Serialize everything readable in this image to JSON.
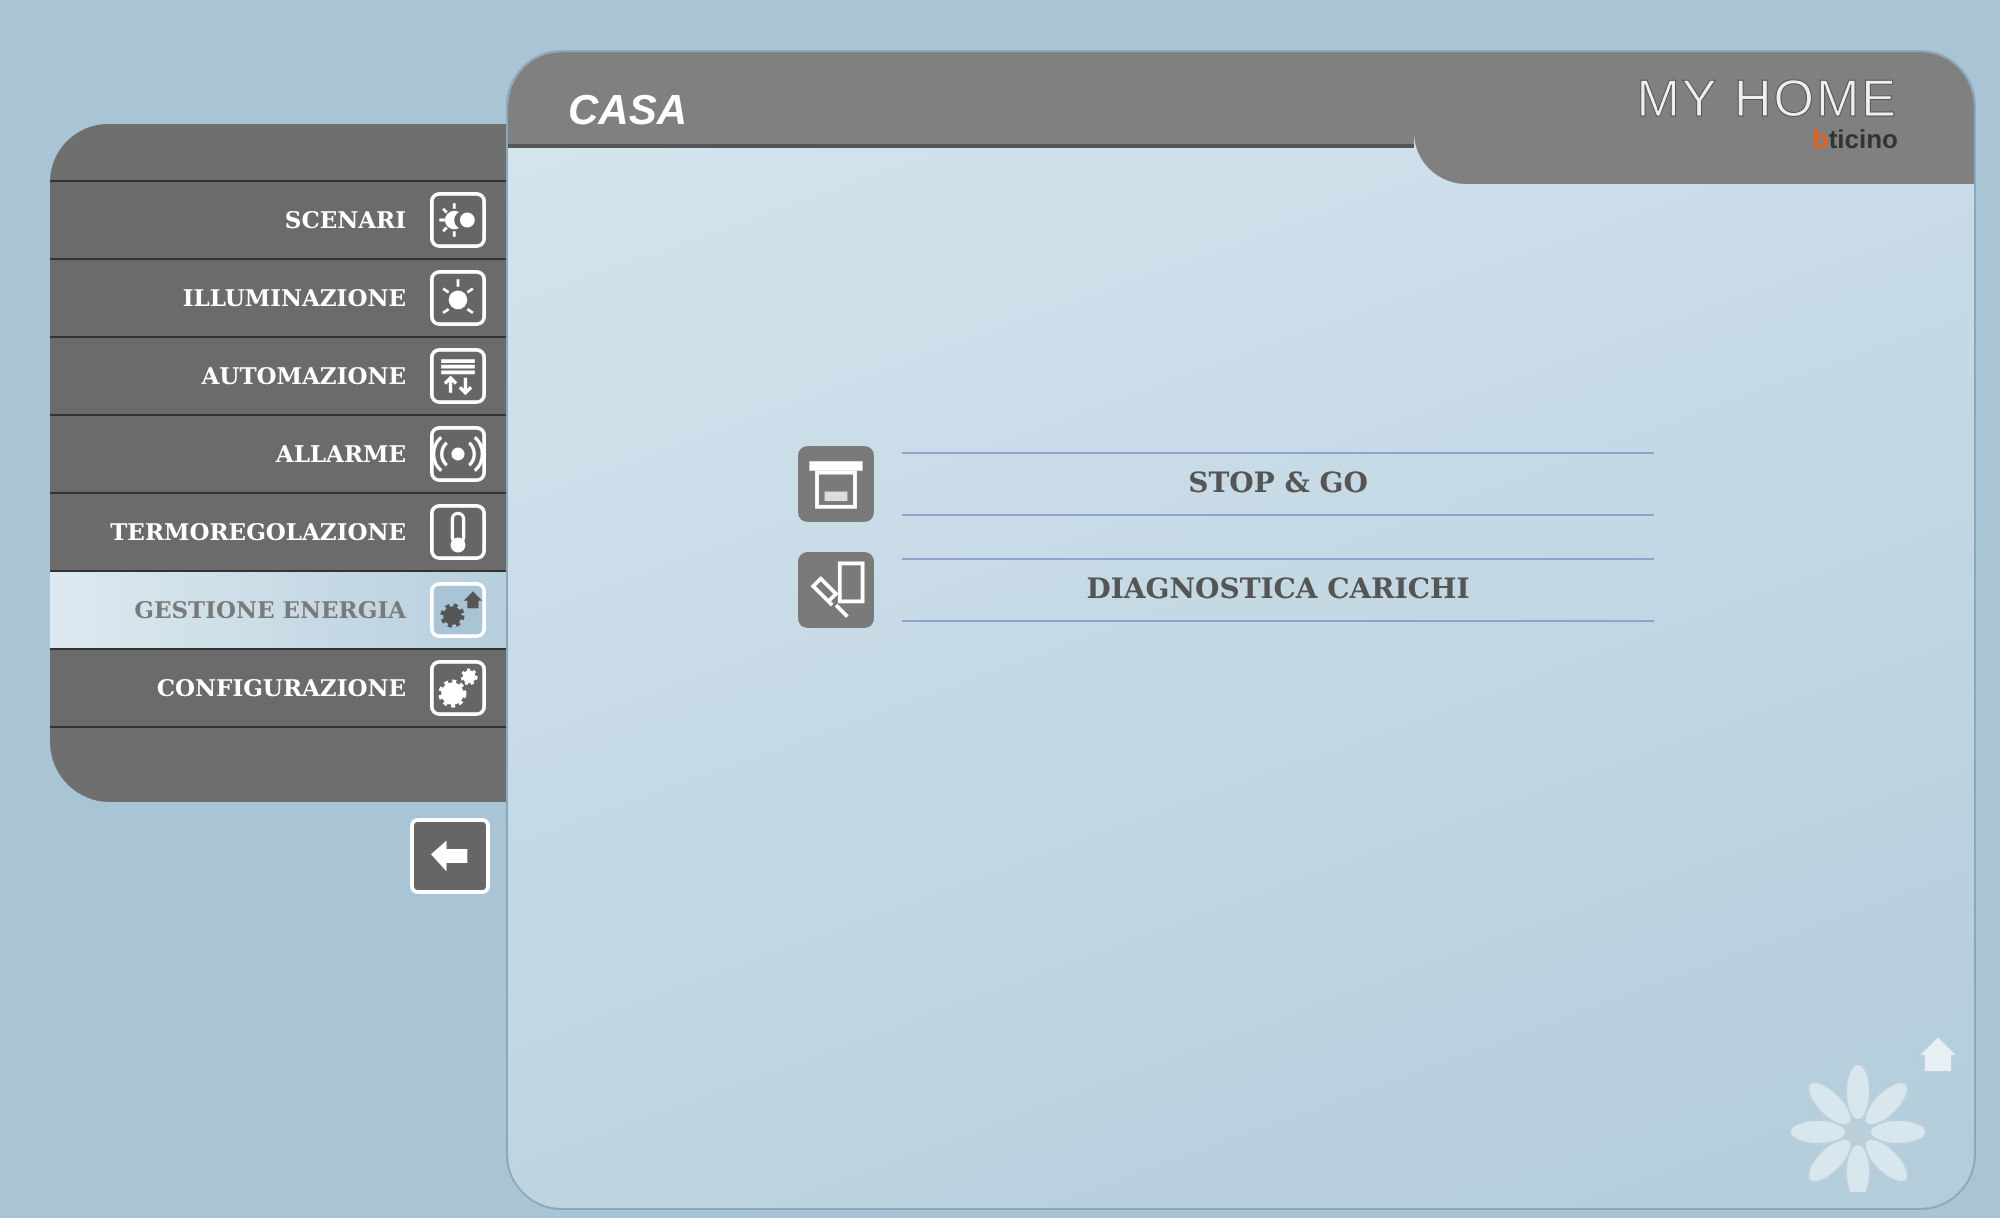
{
  "header": {
    "title": "CASA",
    "logo": "MY HOME",
    "brand": "bticino"
  },
  "sidebar": {
    "items": [
      {
        "label": "SCENARI",
        "selected": false
      },
      {
        "label": "ILLUMINAZIONE",
        "selected": false
      },
      {
        "label": "AUTOMAZIONE",
        "selected": false
      },
      {
        "label": "ALLARME",
        "selected": false
      },
      {
        "label": "TERMOREGOLAZIONE",
        "selected": false
      },
      {
        "label": "GESTIONE ENERGIA",
        "selected": true
      },
      {
        "label": "CONFIGURAZIONE",
        "selected": false
      }
    ]
  },
  "menu": [
    {
      "label": "STOP & GO"
    },
    {
      "label": "DIAGNOSTICA CARICHI"
    }
  ]
}
